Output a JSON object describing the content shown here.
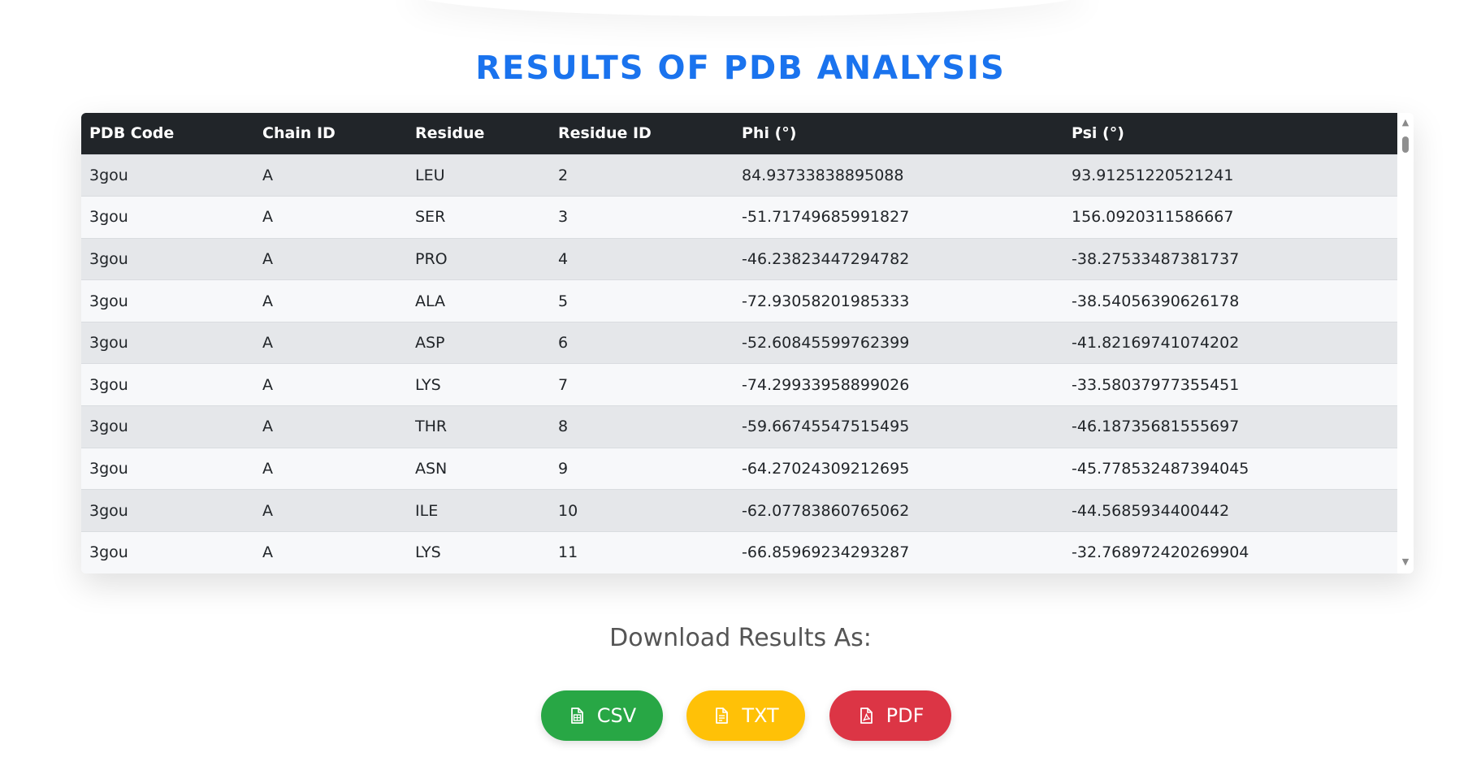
{
  "page": {
    "title": "RESULTS OF PDB ANALYSIS"
  },
  "table": {
    "headers": [
      "PDB Code",
      "Chain ID",
      "Residue",
      "Residue ID",
      "Phi (°)",
      "Psi (°)"
    ],
    "rows": [
      [
        "3gou",
        "A",
        "LEU",
        "2",
        "84.93733838895088",
        "93.91251220521241"
      ],
      [
        "3gou",
        "A",
        "SER",
        "3",
        "-51.71749685991827",
        "156.0920311586667"
      ],
      [
        "3gou",
        "A",
        "PRO",
        "4",
        "-46.23823447294782",
        "-38.27533487381737"
      ],
      [
        "3gou",
        "A",
        "ALA",
        "5",
        "-72.93058201985333",
        "-38.54056390626178"
      ],
      [
        "3gou",
        "A",
        "ASP",
        "6",
        "-52.60845599762399",
        "-41.82169741074202"
      ],
      [
        "3gou",
        "A",
        "LYS",
        "7",
        "-74.29933958899026",
        "-33.58037977355451"
      ],
      [
        "3gou",
        "A",
        "THR",
        "8",
        "-59.66745547515495",
        "-46.18735681555697"
      ],
      [
        "3gou",
        "A",
        "ASN",
        "9",
        "-64.27024309212695",
        "-45.778532487394045"
      ],
      [
        "3gou",
        "A",
        "ILE",
        "10",
        "-62.07783860765062",
        "-44.5685934400442"
      ],
      [
        "3gou",
        "A",
        "LYS",
        "11",
        "-66.85969234293287",
        "-32.768972420269904"
      ]
    ]
  },
  "download": {
    "heading": "Download Results As:",
    "buttons": [
      {
        "label": "CSV",
        "icon": "spreadsheet-file-icon",
        "color": "#28a745"
      },
      {
        "label": "TXT",
        "icon": "text-file-icon",
        "color": "#ffc107"
      },
      {
        "label": "PDF",
        "icon": "pdf-file-icon",
        "color": "#dc3545"
      }
    ]
  },
  "colors": {
    "title": "#1a73ee",
    "table_header_bg": "#212529"
  }
}
